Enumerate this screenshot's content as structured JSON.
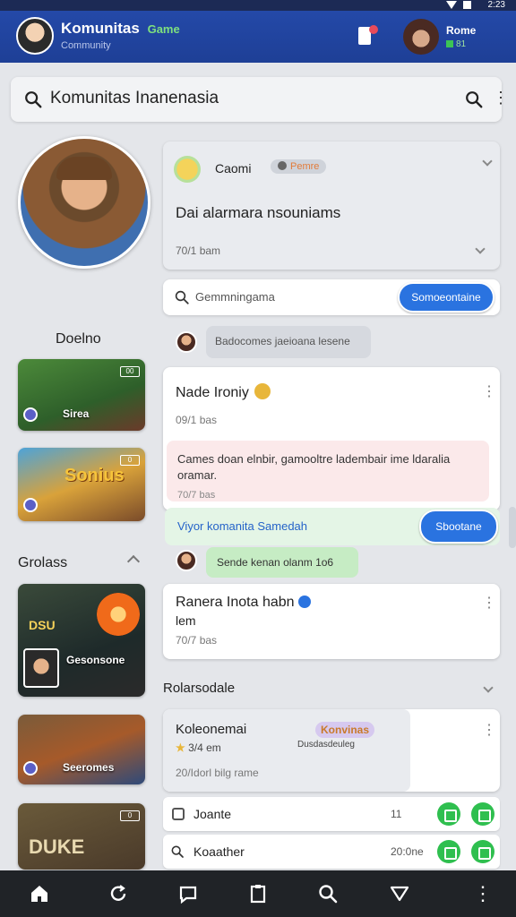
{
  "status": {
    "time": "2:23"
  },
  "header": {
    "title": "Komunitas",
    "badge": "Game",
    "subtitle": "Community",
    "user_name": "Rome",
    "user_stat": "81"
  },
  "search": {
    "value": "Komunitas Inanenasia"
  },
  "sidebar": {
    "section1": "Doelno",
    "section2": "Grolass",
    "thumbs": [
      {
        "label": "Sirea",
        "badge": "00"
      },
      {
        "label": "Sonius",
        "badge": "0"
      },
      {
        "label": "Gesonsone",
        "badge": "",
        "caption": "DSU"
      },
      {
        "label": "Seeromes",
        "badge": ""
      },
      {
        "label": "DUKE",
        "badge": "0"
      }
    ]
  },
  "feed": {
    "top_card": {
      "name": "Caomi",
      "pill": "Pemre",
      "title": "Dai alarmara nsouniams",
      "meta": "70/1 bam"
    },
    "search2": {
      "placeholder": "Gemmningama",
      "button": "Somoeontaine"
    },
    "grey_bubble": "Badocomes jaeioana lesene",
    "post1": {
      "name": "Nade Ironiy",
      "meta": "09/1 bas",
      "body": "Cames doan elnbir, gamooltre ladembair ime ldaralia oramar.",
      "body_meta": "70/7 bas"
    },
    "green_row": {
      "text": "Viyor komanita Samedah",
      "button": "Sbootane"
    },
    "green_bubble": "Sende kenan olanm 1o6",
    "post2": {
      "name": "Ranera Inota habn",
      "sub": "lem",
      "meta": "70/7 bas"
    },
    "section_title": "Rolarsodale",
    "post3": {
      "name": "Koleonemai",
      "tag": "Konvinas",
      "stars": "3/4 em",
      "desc": "Dusdasdeuleg",
      "meta": "20/Idorl bilg rame"
    },
    "rows": [
      {
        "label": "Joante",
        "num": "11"
      },
      {
        "label": "Koaather",
        "num": "20:0ne"
      }
    ]
  },
  "colors": {
    "header": "#1e3f96",
    "accent": "#2a73e0",
    "success": "#2fbf4f"
  }
}
